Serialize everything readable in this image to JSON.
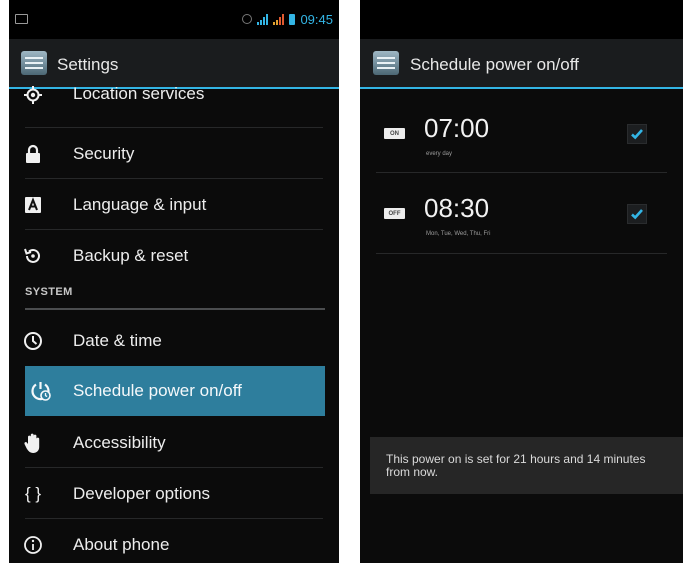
{
  "left": {
    "status_bar": {
      "time": "09:45"
    },
    "title": "Settings",
    "items": [
      {
        "label": "Location services",
        "icon": "location-icon"
      },
      {
        "label": "Security",
        "icon": "lock-icon"
      },
      {
        "label": "Language & input",
        "icon": "keyboard-icon"
      },
      {
        "label": "Backup & reset",
        "icon": "backup-icon"
      }
    ],
    "section_header": "SYSTEM",
    "system_items": [
      {
        "label": "Date & time",
        "icon": "clock-icon"
      },
      {
        "label": "Schedule power on/off",
        "icon": "power-schedule-icon",
        "selected": true
      },
      {
        "label": "Accessibility",
        "icon": "hand-icon"
      },
      {
        "label": "Developer options",
        "icon": "braces-icon",
        "icon_text": "{ }"
      },
      {
        "label": "About phone",
        "icon": "info-icon"
      }
    ]
  },
  "right": {
    "title": "Schedule power on/off",
    "schedules": [
      {
        "tag": "ON",
        "time": "07:00",
        "repeat": "every day",
        "checked": true
      },
      {
        "tag": "OFF",
        "time": "08:30",
        "repeat": "Mon, Tue, Wed, Thu, Fri",
        "checked": true
      }
    ],
    "toast": "This power on is set for 21 hours and 14 minutes from now."
  },
  "colors": {
    "accent": "#33b5e5",
    "selected_row": "#2e7e9d",
    "background": "#0b0b0b",
    "action_bar": "#1a1c1e"
  }
}
